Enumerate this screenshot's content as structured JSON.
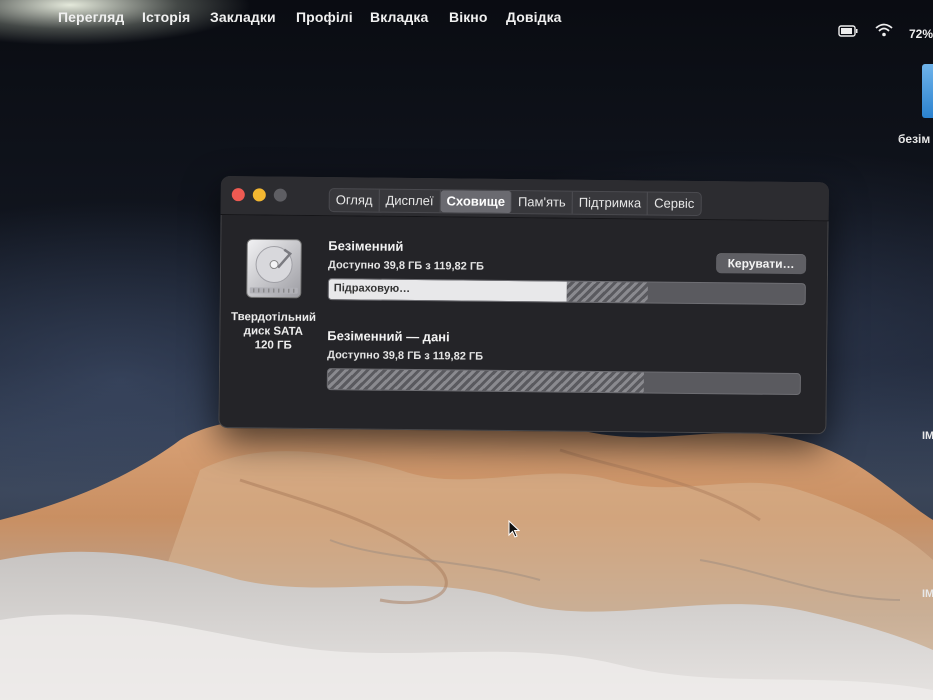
{
  "menubar": {
    "items": [
      "Перегляд",
      "Історія",
      "Закладки",
      "Профілі",
      "Вкладка",
      "Вікно",
      "Довідка"
    ],
    "battery_percent": "72%"
  },
  "desktop": {
    "folder_label": "безім",
    "side_label_1": "IM",
    "side_label_2": "IM"
  },
  "window": {
    "tabs": [
      "Огляд",
      "Дисплеї",
      "Сховище",
      "Пам'ять",
      "Підтримка",
      "Сервіс"
    ],
    "active_tab": "Сховище",
    "disk": {
      "caption_line1": "Твердотільний",
      "caption_line2": "диск SATA",
      "caption_line3": "120 ГБ"
    },
    "volumes": [
      {
        "name": "Безіменний",
        "available": "Доступно 39,8 ГБ з 119,82 ГБ",
        "bar_label": "Підраховую…",
        "calculating_fraction": 0.5,
        "used_fraction": 0.67
      },
      {
        "name": "Безіменний — дані",
        "available": "Доступно 39,8 ГБ з 119,82 ГБ",
        "used_fraction": 0.67
      }
    ],
    "manage_button": "Керувати…"
  },
  "colors": {
    "close": "#ee5a52",
    "minimize": "#f3b731",
    "window_bg": "#242428",
    "storage_hatch": "#8a8a8f"
  }
}
